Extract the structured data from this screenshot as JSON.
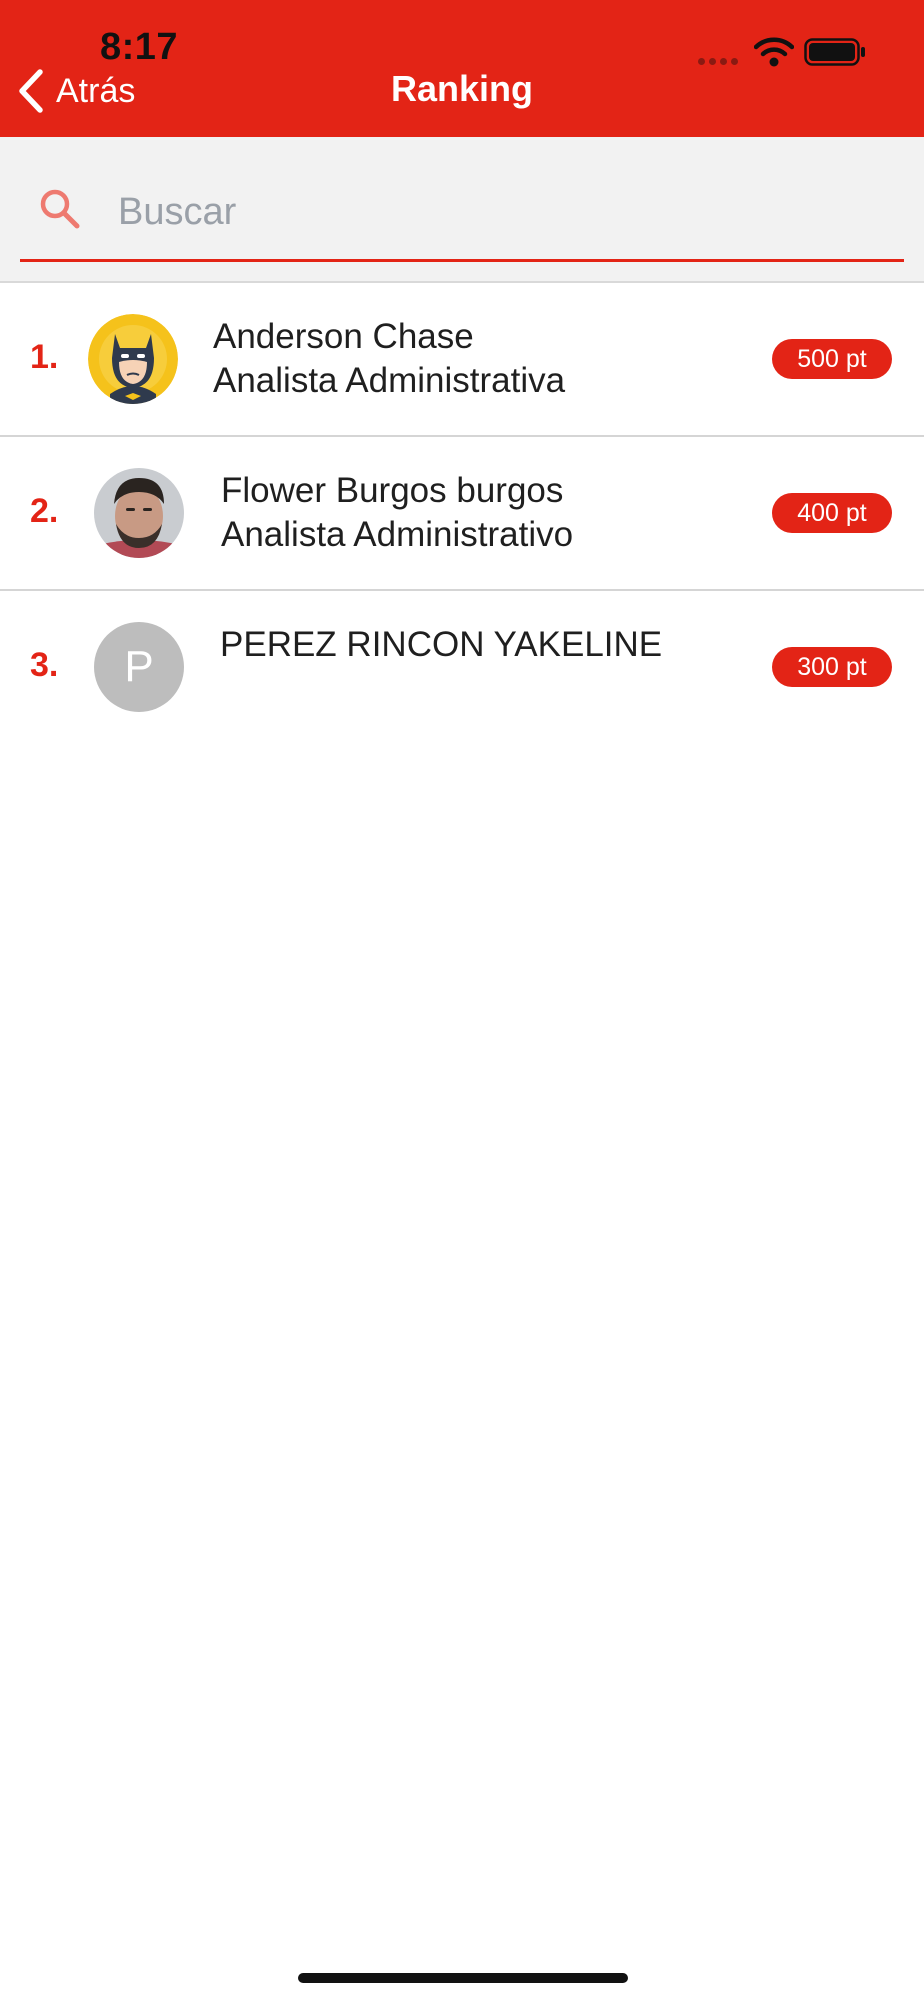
{
  "status_bar": {
    "time": "8:17",
    "icons": [
      "cellular-signal-icon",
      "wifi-icon",
      "battery-icon"
    ]
  },
  "nav_bar": {
    "back_label": "Atrás",
    "title": "Ranking",
    "back_icon": "chevron-left-icon"
  },
  "search": {
    "placeholder": "Buscar",
    "value": "",
    "icon": "search-icon"
  },
  "ranking": [
    {
      "rank": "1.",
      "name": "Anderson Chase",
      "role": "Analista Administrativa",
      "points": "500 pt",
      "avatar": "batman-avatar-icon"
    },
    {
      "rank": "2.",
      "name": "Flower Burgos burgos",
      "role": "Analista Administrativo",
      "points": "400 pt",
      "avatar": "user-photo"
    },
    {
      "rank": "3.",
      "name": "PEREZ RINCON YAKELINE",
      "role": "",
      "points": "300 pt",
      "avatar_initial": "P"
    }
  ],
  "colors": {
    "brand_red": "#e32416",
    "search_background": "#f2f2f2",
    "placeholder_gray": "#9aa0a8",
    "initial_avatar_gray": "#bdbdbd"
  }
}
